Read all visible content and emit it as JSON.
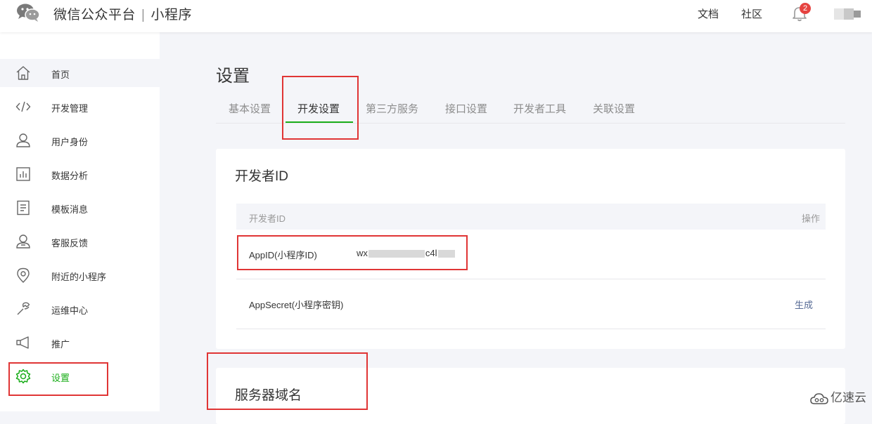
{
  "header": {
    "brand": "微信公众平台",
    "separator": "|",
    "product": "小程序",
    "links": [
      "文档",
      "社区"
    ],
    "notification_count": "2"
  },
  "sidebar": {
    "items": [
      {
        "label": "首页",
        "icon": "home-icon"
      },
      {
        "label": "开发管理",
        "icon": "code-icon"
      },
      {
        "label": "用户身份",
        "icon": "user-icon"
      },
      {
        "label": "数据分析",
        "icon": "chart-icon"
      },
      {
        "label": "模板消息",
        "icon": "document-icon"
      },
      {
        "label": "客服反馈",
        "icon": "support-icon"
      },
      {
        "label": "附近的小程序",
        "icon": "location-icon"
      },
      {
        "label": "运维中心",
        "icon": "wrench-icon"
      },
      {
        "label": "推广",
        "icon": "megaphone-icon"
      },
      {
        "label": "设置",
        "icon": "gear-icon"
      }
    ],
    "active_item": "首页",
    "current_item": "设置"
  },
  "main": {
    "title": "设置",
    "tabs": [
      "基本设置",
      "开发设置",
      "第三方服务",
      "接口设置",
      "开发者工具",
      "关联设置"
    ],
    "active_tab": "开发设置",
    "developer_card": {
      "title": "开发者ID",
      "header_left": "开发者ID",
      "header_right": "操作",
      "rows": [
        {
          "label": "AppID(小程序ID)",
          "value_prefix": "wx",
          "value_mid": "c4l",
          "action": ""
        },
        {
          "label": "AppSecret(小程序密钥)",
          "value": "",
          "action": "生成"
        }
      ]
    },
    "server_card": {
      "title": "服务器域名"
    }
  },
  "watermark": "亿速云",
  "colors": {
    "accent_green": "#1aad19",
    "link_blue": "#576b95",
    "highlight_red": "#e03535",
    "badge_red": "#e64340"
  }
}
